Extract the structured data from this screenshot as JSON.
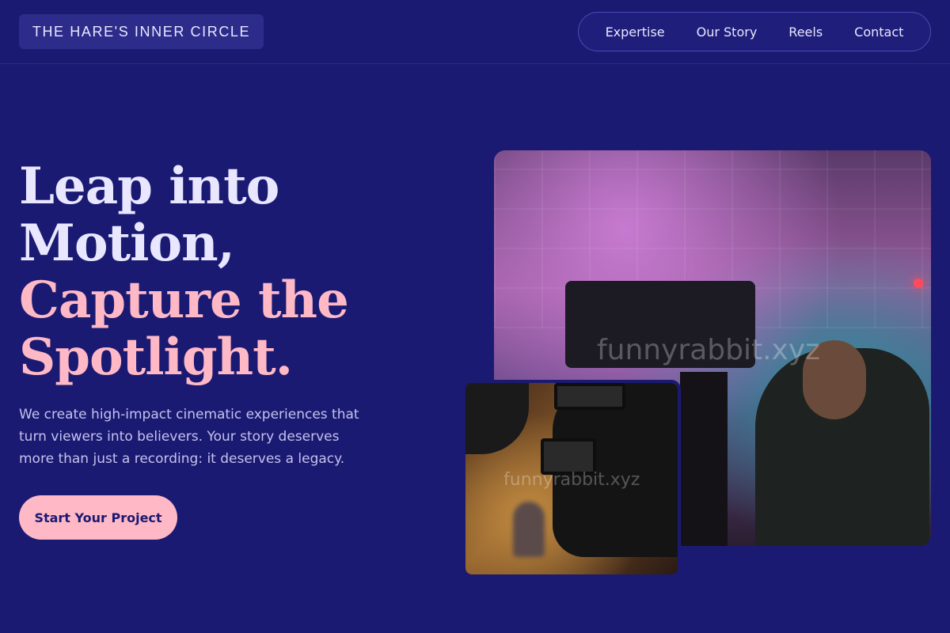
{
  "header": {
    "brand": "THE HARE'S INNER CIRCLE",
    "nav": [
      "Expertise",
      "Our Story",
      "Reels",
      "Contact"
    ]
  },
  "hero": {
    "title_line1": "Leap into",
    "title_line2": "Motion,",
    "title_line3": "Capture the",
    "title_line4": "Spotlight.",
    "subtitle": "We create high-impact cinematic experiences that turn viewers into believers. Your story deserves more than just a recording: it deserves a legacy.",
    "cta_label": "Start Your Project"
  },
  "media": {
    "main_photo_watermark": "funnyrabbit.xyz",
    "inset_photo_watermark": "funnyrabbit.xyz"
  },
  "colors": {
    "background": "#1b1a72",
    "accent": "#ffb8c6",
    "text": "#e8e7ff"
  }
}
